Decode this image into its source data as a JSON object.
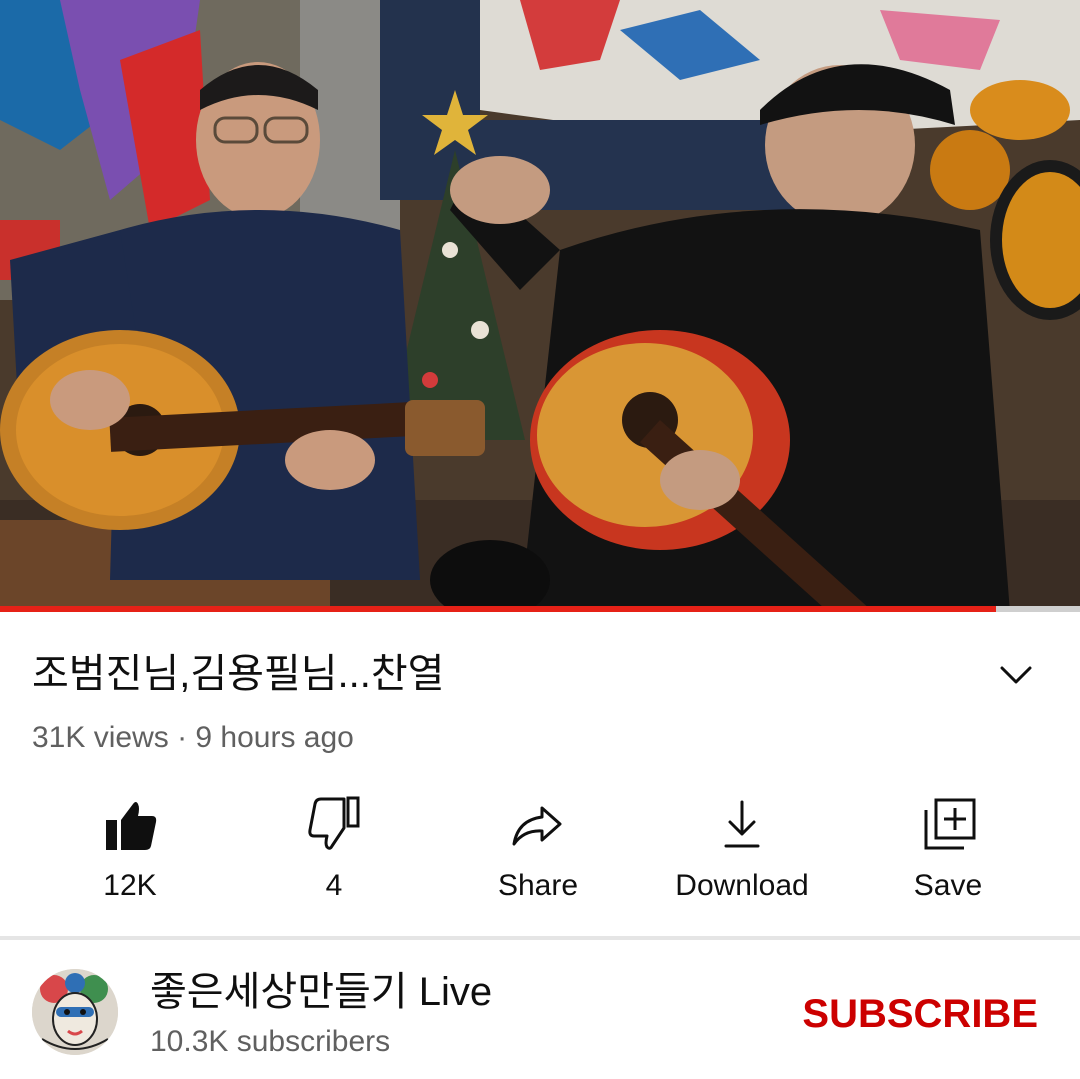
{
  "player": {
    "progress_fraction": 0.922,
    "progress_color": "#e62117",
    "track_color": "#cfcfcf"
  },
  "video": {
    "title": "조범진님,김용필님...찬열",
    "meta": "31K views · 9 hours ago"
  },
  "actions": [
    {
      "icon": "thumbs-up-icon",
      "label": "12K"
    },
    {
      "icon": "thumbs-down-icon",
      "label": "4"
    },
    {
      "icon": "share-icon",
      "label": "Share"
    },
    {
      "icon": "download-icon",
      "label": "Download"
    },
    {
      "icon": "save-playlist-icon",
      "label": "Save"
    }
  ],
  "channel": {
    "name": "좋은세상만들기 Live",
    "subscribers": "10.3K subscribers",
    "subscribe_label": "SUBSCRIBE",
    "subscribe_color": "#cc0000"
  }
}
